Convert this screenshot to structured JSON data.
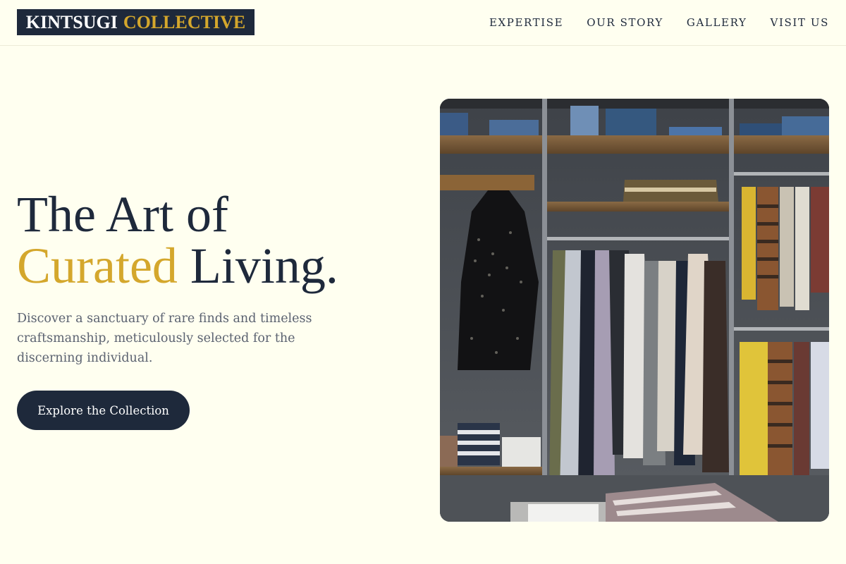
{
  "header": {
    "logo_part1": "KINTSUGI",
    "logo_part2": "COLLECTIVE",
    "nav": [
      {
        "label": "EXPERTISE"
      },
      {
        "label": "OUR STORY"
      },
      {
        "label": "GALLERY"
      },
      {
        "label": "VISIT US"
      }
    ]
  },
  "hero": {
    "headline_line1": "The Art of",
    "headline_accent": "Curated",
    "headline_line2_rest": " Living.",
    "subtitle": "Discover a sanctuary of rare finds and timeless craftsmanship, meticulously selected for the discerning individual.",
    "cta_label": "Explore the Collection",
    "image_alt": "Boutique clothing racks with dresses, striped shirts and folded denim on wooden shelves"
  },
  "colors": {
    "background": "#fffff0",
    "navy": "#1e293b",
    "gold": "#d4a72c",
    "muted_text": "#5b6270"
  }
}
